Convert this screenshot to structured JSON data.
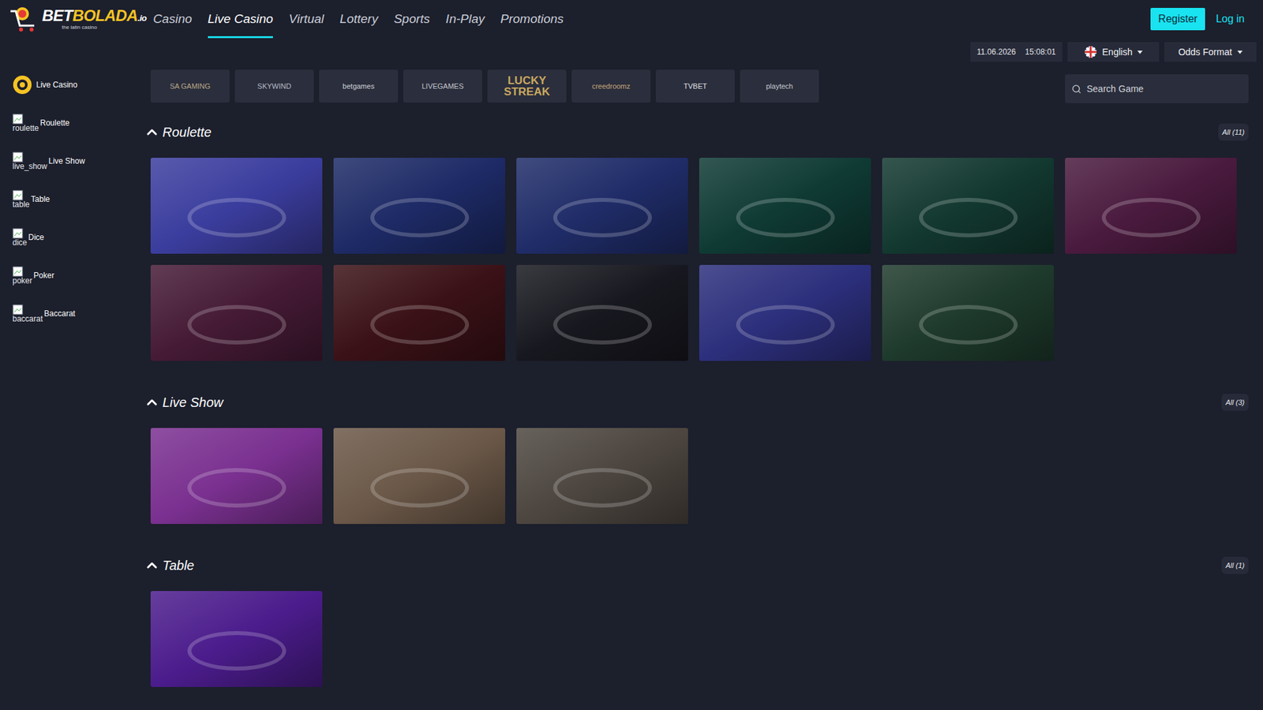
{
  "nav": {
    "logo": {
      "parts": [
        {
          "text": "BET",
          "color": "#ffffff"
        },
        {
          "text": "BOLADA",
          "color": "#f6c324"
        },
        {
          "text": ".io",
          "color": "#ffffff"
        }
      ],
      "tagline": "the latin casino"
    },
    "items": [
      {
        "label": "Casino",
        "selected": false
      },
      {
        "label": "Live Casino",
        "selected": true
      },
      {
        "label": "Virtual",
        "selected": false
      },
      {
        "label": "Lottery",
        "selected": false
      },
      {
        "label": "Sports",
        "selected": false
      },
      {
        "label": "In-Play",
        "selected": false
      },
      {
        "label": "Promotions",
        "selected": false
      }
    ],
    "register": "Register",
    "login": "Log in"
  },
  "toolbar": {
    "date": "11.06.2026",
    "time": "15:08:01",
    "language": "English",
    "odds_format": "Odds Format"
  },
  "sidebar": {
    "items": [
      {
        "label": "Live Casino",
        "kind": "chip",
        "icon_alt": ""
      },
      {
        "label": "Roulette",
        "kind": "broken",
        "icon_alt": "roulette"
      },
      {
        "label": "Live Show",
        "kind": "broken",
        "icon_alt": "live_show"
      },
      {
        "label": "Table",
        "kind": "broken",
        "icon_alt": "table"
      },
      {
        "label": "Dice",
        "kind": "broken",
        "icon_alt": "dice"
      },
      {
        "label": "Poker",
        "kind": "broken",
        "icon_alt": "poker"
      },
      {
        "label": "Baccarat",
        "kind": "broken",
        "icon_alt": "baccarat"
      }
    ]
  },
  "providers": [
    {
      "name": "SA GAMING",
      "color": "#b9a88a"
    },
    {
      "name": "SKYWIND",
      "color": "#b8bcc6"
    },
    {
      "name": "betgames",
      "color": "#d0d3da"
    },
    {
      "name": "LIVEGAMES",
      "color": "#c4c7cf"
    },
    {
      "name": "LUCKY STREAK",
      "color": "#c9a860"
    },
    {
      "name": "creedroomz",
      "color": "#c7a77c"
    },
    {
      "name": "TVBET",
      "color": "#e0e2e8"
    },
    {
      "name": "playtech",
      "color": "#c8cbd2"
    }
  ],
  "search": {
    "placeholder": "Search Game"
  },
  "sections": [
    {
      "title": "Roulette",
      "count": "All (11)",
      "expanded": true,
      "tiles": [
        {
          "color": "#3b3d9e"
        },
        {
          "color": "#1d2a66"
        },
        {
          "color": "#1f2c68"
        },
        {
          "color": "#0f3a34"
        },
        {
          "color": "#12382f"
        },
        {
          "color": "#4a1a3e"
        },
        {
          "color": "#451a35"
        },
        {
          "color": "#3a1116"
        },
        {
          "color": "#17171f"
        },
        {
          "color": "#2c2f7c"
        },
        {
          "color": "#1e3a2c"
        }
      ]
    },
    {
      "title": "Live Show",
      "count": "All (3)",
      "expanded": true,
      "tiles": [
        {
          "color": "#7a3090"
        },
        {
          "color": "#6b5848"
        },
        {
          "color": "#4d4640"
        }
      ]
    },
    {
      "title": "Table",
      "count": "All (1)",
      "expanded": true,
      "tiles": [
        {
          "color": "#4b1c8c"
        }
      ]
    }
  ]
}
